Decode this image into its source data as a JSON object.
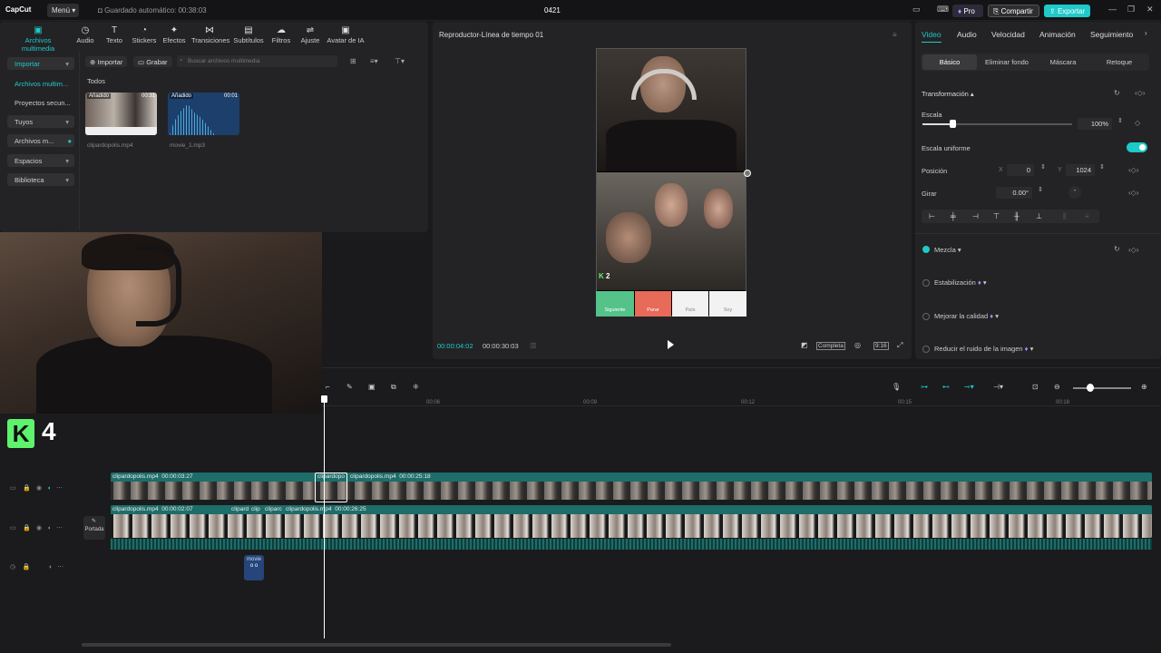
{
  "topbar": {
    "logo": "CapCut",
    "menu": "Menú",
    "autosave": "Guardado automático: 00:38:03",
    "project_title": "0421",
    "pro": "Pro",
    "share": "Compartir",
    "export": "Exportar"
  },
  "media_tools": [
    {
      "label": "Archivos multimedia",
      "icon": "media-icon",
      "active": true
    },
    {
      "label": "Audio",
      "icon": "audio-icon"
    },
    {
      "label": "Texto",
      "icon": "text-icon"
    },
    {
      "label": "Stickers",
      "icon": "sticker-icon"
    },
    {
      "label": "Efectos",
      "icon": "effects-icon"
    },
    {
      "label": "Transiciones",
      "icon": "transition-icon"
    },
    {
      "label": "Subtítulos",
      "icon": "subtitles-icon"
    },
    {
      "label": "Filtros",
      "icon": "filter-icon"
    },
    {
      "label": "Ajuste",
      "icon": "adjust-icon"
    },
    {
      "label": "Avatar de IA",
      "icon": "avatar-icon"
    }
  ],
  "sidebar": {
    "items": [
      {
        "label": "Importar"
      },
      {
        "label": "Archivos multim..."
      },
      {
        "label": "Proyectos secun..."
      },
      {
        "label": "Tuyos"
      },
      {
        "label": "Archivos m..."
      },
      {
        "label": "Espacios"
      },
      {
        "label": "Biblioteca"
      }
    ]
  },
  "media": {
    "import_btn": "Importar",
    "record_btn": "Grabar",
    "search_placeholder": "Buscar archivos multimedia",
    "filter_all": "Todos",
    "items": [
      {
        "badge": "Añadido",
        "duration": "00:31",
        "name": "clipardopolis.mp4"
      },
      {
        "badge": "Añadido",
        "duration": "00:01",
        "name": "movie_1.mp3"
      }
    ]
  },
  "player": {
    "title": "Reproductor-Línea de tiempo 01",
    "current_time": "00:00:04:02",
    "total_time": "00:00:30:03",
    "overlay_count": "2",
    "buttons": [
      "Siguiente",
      "Parar",
      "País",
      "Soy"
    ],
    "complete_label": "Completa",
    "ratio_label": "9:16"
  },
  "properties": {
    "tabs": [
      "Video",
      "Audio",
      "Velocidad",
      "Animación",
      "Seguimiento"
    ],
    "subtabs": [
      "Básico",
      "Eliminar fondo",
      "Máscara",
      "Retoque"
    ],
    "transform": "Transformación",
    "scale_label": "Escala",
    "scale_value": "100%",
    "scale_fraction": 0.2,
    "uniform_label": "Escala uniforme",
    "position_label": "Posición",
    "pos_x_label": "X",
    "pos_x": "0",
    "pos_y_label": "Y",
    "pos_y": "1024",
    "rotate_label": "Girar",
    "rotate_value": "0.00°",
    "blend_label": "Mezcla",
    "stabilize_label": "Estabilización",
    "quality_label": "Mejorar la calidad",
    "noise_label": "Reducir el ruido de la imagen"
  },
  "overlay": {
    "k_label": "K",
    "k_number": "4"
  },
  "timeline": {
    "ruler": [
      "00:06",
      "00:09",
      "00:12",
      "00:15",
      "00:18"
    ],
    "track1": [
      {
        "label": "clipardopolis.mp4",
        "duration": "00:00:03:27"
      },
      {
        "label": "clipardopo",
        "duration": ""
      },
      {
        "label": "clipardopolis.mp4",
        "duration": "00:00:25:18"
      }
    ],
    "track2": [
      {
        "label": "clipardopolis.mp4",
        "duration": "00:00:02:07"
      },
      {
        "label": "clipard",
        "duration": ""
      },
      {
        "label": "clip",
        "duration": ""
      },
      {
        "label": "cliparc",
        "duration": ""
      },
      {
        "label": "clipardopolis.mp4",
        "duration": "00:00:26:25"
      }
    ],
    "cover_label": "Portada",
    "audio_clip": "movie"
  }
}
